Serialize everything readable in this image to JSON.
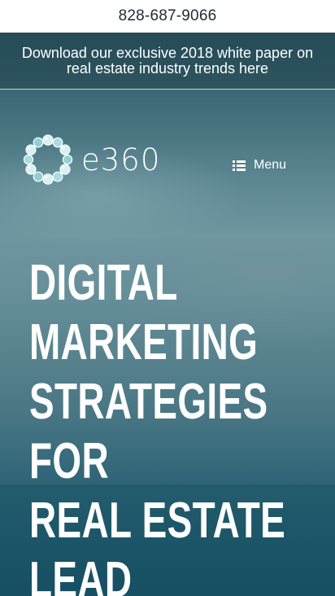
{
  "header": {
    "phone": "828-687-9066"
  },
  "promo": {
    "text": "Download our exclusive 2018 white paper on real estate industry trends here"
  },
  "brand": {
    "logo_text": "e360",
    "colors": {
      "logo_bubble_light": "#d8f0f2",
      "logo_bubble_mid": "#8fd0d6",
      "logo_bubble_dark": "#4fa9b3"
    }
  },
  "nav": {
    "menu_label": "Menu",
    "menu_icon": "list-icon"
  },
  "hero": {
    "headline_lines": [
      "Digital",
      "Marketing",
      "Strategies",
      "for",
      "Real Estate",
      "Lead"
    ]
  },
  "theme": {
    "text_color": "#ffffff",
    "phone_color": "#1f2a33"
  }
}
